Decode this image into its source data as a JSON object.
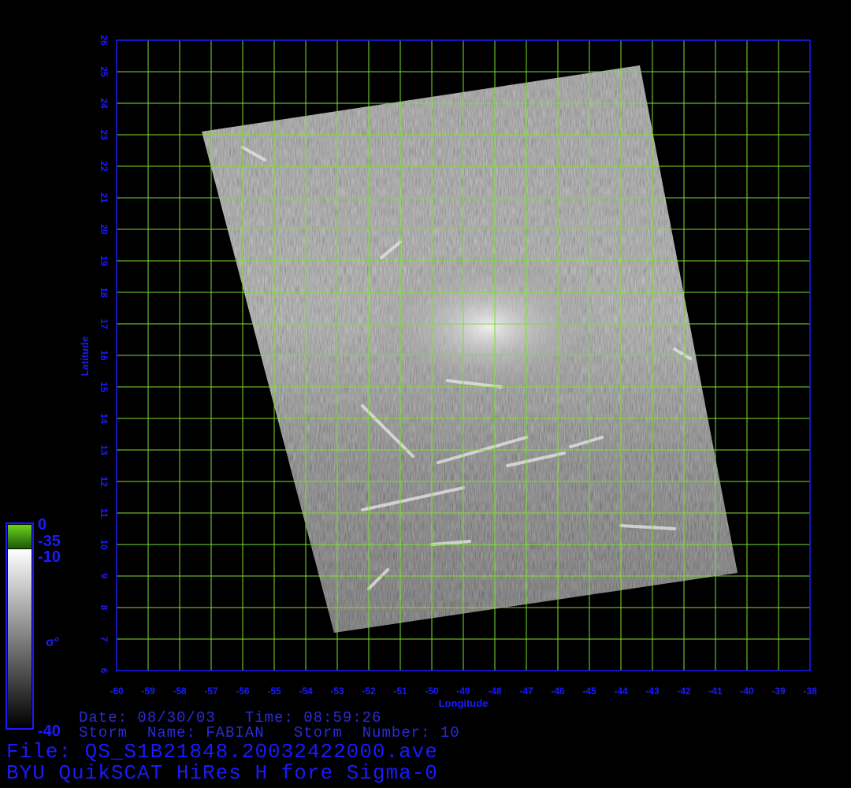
{
  "map": {
    "lon_min": -60,
    "lon_max": -38,
    "lat_min": 6,
    "lat_max": 26,
    "lon_ticks": [
      -60,
      -59,
      -58,
      -57,
      -56,
      -55,
      -54,
      -53,
      -52,
      -51,
      -50,
      -49,
      -48,
      -47,
      -46,
      -45,
      -44,
      -43,
      -42,
      -41,
      -40,
      -39,
      -38
    ],
    "lat_ticks": [
      6,
      7,
      8,
      9,
      10,
      11,
      12,
      13,
      14,
      15,
      16,
      17,
      18,
      19,
      20,
      21,
      22,
      23,
      24,
      25,
      26
    ],
    "xlabel": "Longitude",
    "ylabel": "Latitude",
    "grid_color": "#7ee02a",
    "axis_color": "#1a1aff",
    "swath_corners_lonlat": [
      [
        -57.3,
        23.1
      ],
      [
        -43.4,
        25.2
      ],
      [
        -40.3,
        9.1
      ],
      [
        -53.1,
        7.2
      ]
    ]
  },
  "colorbar": {
    "symbol": "σ°",
    "labels": {
      "top": "0",
      "upper": "-35",
      "mid": "-10",
      "bottom": "-40"
    },
    "green": "#3a9a10"
  },
  "info": {
    "date_line": "Date: 08/30/03   Time: 08:59:26",
    "storm_line": "Storm  Name: FABIAN   Storm  Number: 10",
    "file_line": "File: QS_S1B21848.20032422000.ave",
    "product_line": "BYU QuikSCAT HiRes H fore Sigma-0"
  }
}
